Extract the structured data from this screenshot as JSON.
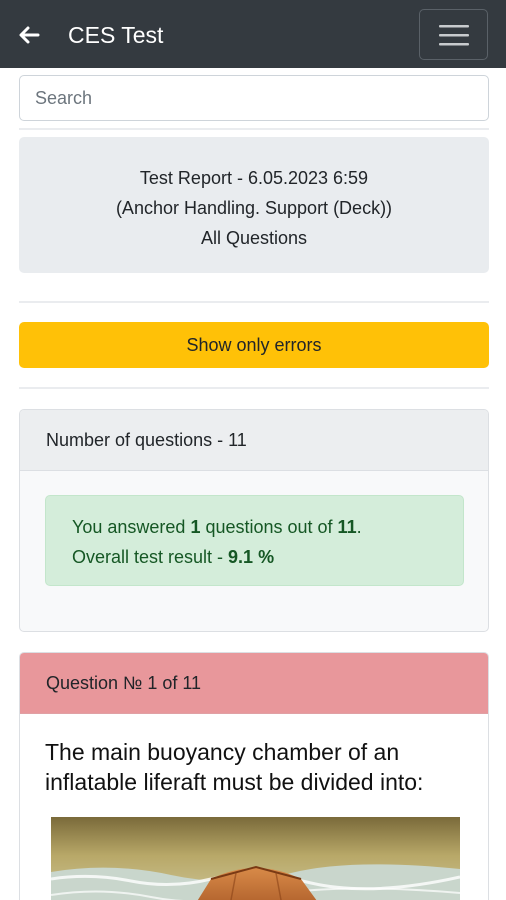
{
  "header": {
    "title": "CES Test"
  },
  "search": {
    "placeholder": "Search"
  },
  "report": {
    "line1": "Test Report - 6.05.2023 6:59",
    "line2": "(Anchor Handling. Support (Deck))",
    "line3": "All Questions"
  },
  "errors_button": {
    "label": "Show only errors"
  },
  "summary": {
    "header": "Number of questions - 11",
    "answered_prefix": "You answered ",
    "answered_count": "1",
    "answered_mid": " questions out of ",
    "total": "11",
    "answered_suffix": ".",
    "result_prefix": "Overall test result - ",
    "result_value": "9.1 %"
  },
  "question": {
    "header": "Question № 1 of 11",
    "text": "The main buoyancy chamber of an inflatable liferaft must be divided into:"
  },
  "colors": {
    "navbar": "#343a40",
    "warning": "#ffc107",
    "success_bg": "#d4edda",
    "success_text": "#155724",
    "danger_header": "#e8979b"
  }
}
